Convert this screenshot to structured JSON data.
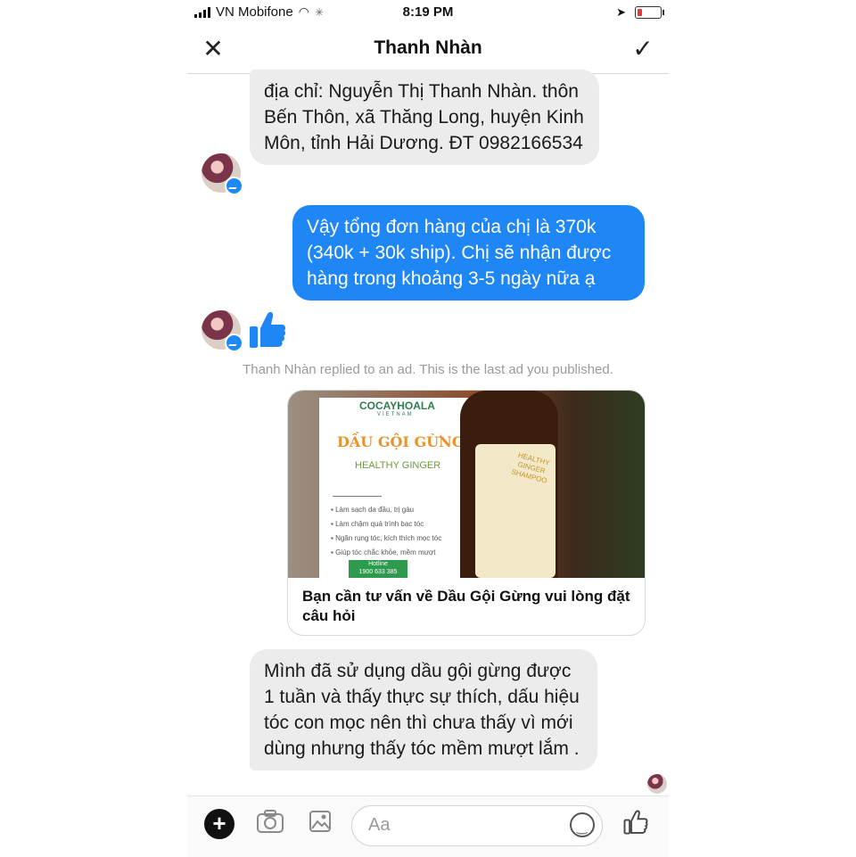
{
  "status_bar": {
    "carrier": "VN Mobifone",
    "time": "8:19 PM",
    "battery_level": 0.2
  },
  "header": {
    "title": "Thanh Nhàn",
    "close_icon": "close-icon",
    "done_icon": "check-icon"
  },
  "messages": {
    "m1": "địa chỉ: Nguyễn Thị Thanh Nhàn. thôn Bến Thôn, xã Thăng Long, huyện Kinh Môn, tỉnh Hải Dương. ĐT 0982166534",
    "m2": "Vậy tổng đơn hàng của chị là 370k (340k + 30k ship). Chị sẽ nhận được hàng trong khoảng 3-5 ngày nữa ạ",
    "like_icon": "thumbs-up-icon",
    "notice": "Thanh Nhàn replied to an ad. This is the last ad you published.",
    "m3": "Mình đã sử dụng dầu gội gừng được 1 tuần và thấy thực sự thích, dấu hiệu tóc con mọc nên thì chưa thấy vì mới dùng nhưng thấy tóc mềm mượt lắm ."
  },
  "ad": {
    "brand": "COCAYHOALA",
    "brand_sub": "VIETNAM",
    "poster_title": "DẦU GỘI GỪNG",
    "poster_subtitle": "HEALTHY GINGER",
    "bullets": [
      "Làm sạch da đầu, trị gàu",
      "Làm chậm quá trình bạc tóc",
      "Ngăn rụng tóc, kích thích mọc tóc",
      "Giúp tóc chắc khỏe, mềm mượt"
    ],
    "hotline_label": "Hotline",
    "hotline": "1900 633 385",
    "bottle_label": "HEALTHY GINGER SHAMPOO",
    "caption": "Bạn cần tư vấn về Dầu Gội Gừng vui lòng đặt câu hỏi"
  },
  "composer": {
    "placeholder": "Aa",
    "icons": [
      "plus-icon",
      "camera-icon",
      "image-icon",
      "emoji-icon",
      "thumbs-up-icon"
    ]
  },
  "colors": {
    "outgoing_bubble": "#1f86f5",
    "incoming_bubble": "#ececec",
    "accent": "#1e88f5"
  }
}
